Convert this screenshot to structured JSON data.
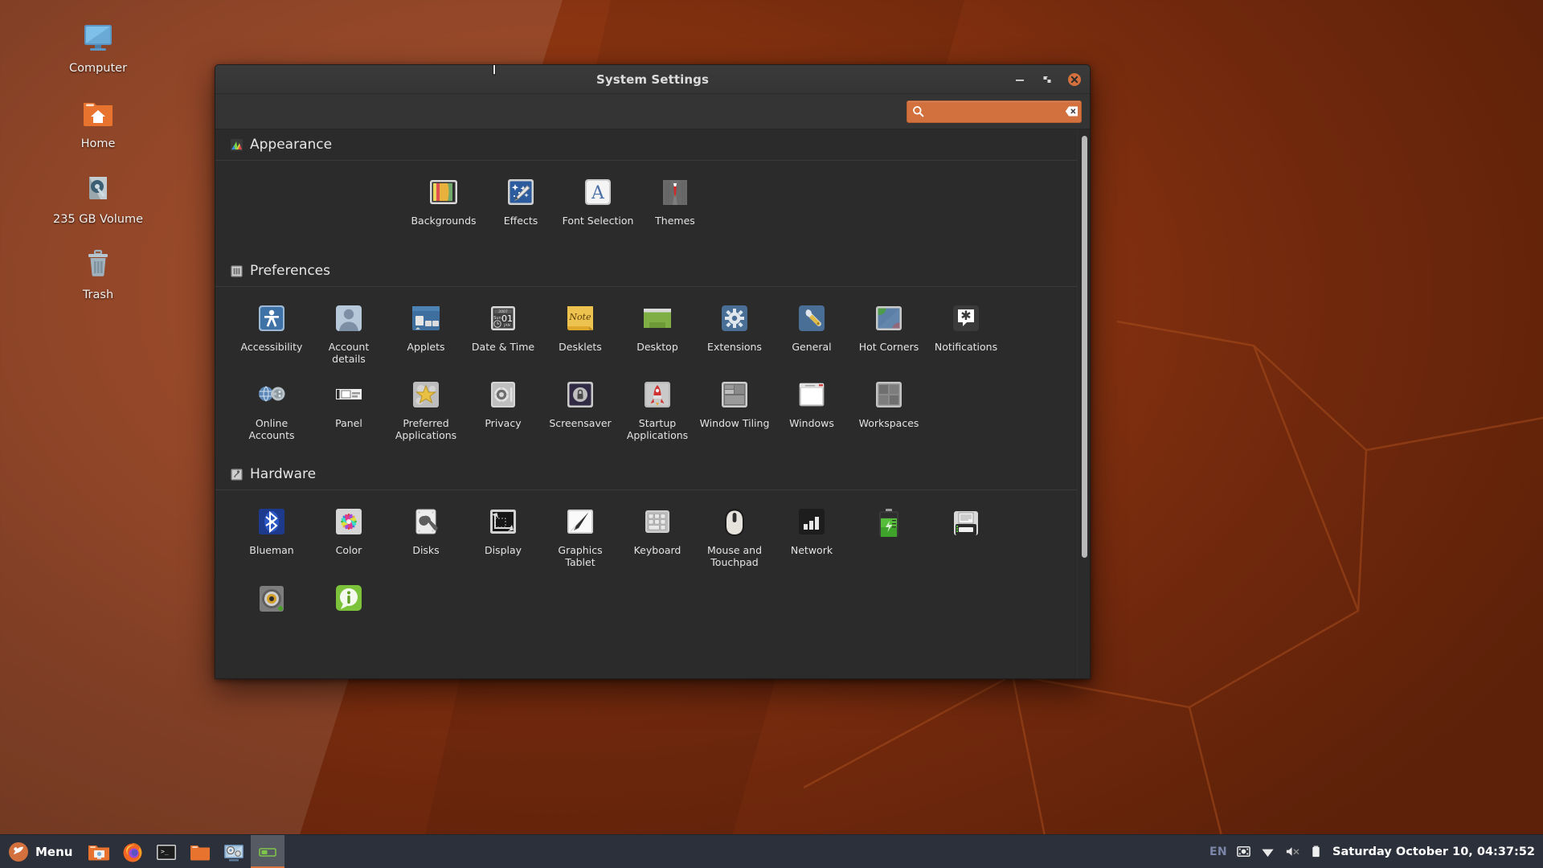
{
  "desktop": {
    "icons": [
      {
        "label": "Computer",
        "icon": "computer-icon"
      },
      {
        "label": "Home",
        "icon": "home-folder-icon"
      },
      {
        "label": "235 GB Volume",
        "icon": "drive-volume-icon"
      },
      {
        "label": "Trash",
        "icon": "trash-icon"
      }
    ]
  },
  "window": {
    "title": "System Settings",
    "controls": {
      "minimize": "minimize-button",
      "maximize": "maximize-button",
      "close": "close-button"
    },
    "search": {
      "value": "",
      "placeholder": "",
      "icon": "search-icon",
      "clear_icon": "clear-icon"
    },
    "scrollbar": {
      "orientation": "vertical"
    }
  },
  "sections": [
    {
      "id": "appearance",
      "title": "Appearance",
      "icon": "appearance-icon",
      "items": [
        {
          "label": "Backgrounds",
          "icon": "backgrounds-icon"
        },
        {
          "label": "Effects",
          "icon": "effects-icon"
        },
        {
          "label": "Font Selection",
          "icon": "font-selection-icon"
        },
        {
          "label": "Themes",
          "icon": "themes-icon"
        }
      ]
    },
    {
      "id": "preferences",
      "title": "Preferences",
      "icon": "preferences-icon",
      "items": [
        {
          "label": "Accessibility",
          "icon": "accessibility-icon"
        },
        {
          "label": "Account details",
          "icon": "account-details-icon"
        },
        {
          "label": "Applets",
          "icon": "applets-icon"
        },
        {
          "label": "Date & Time",
          "icon": "date-time-icon"
        },
        {
          "label": "Desklets",
          "icon": "desklets-icon"
        },
        {
          "label": "Desktop",
          "icon": "desktop-icon"
        },
        {
          "label": "Extensions",
          "icon": "extensions-icon"
        },
        {
          "label": "General",
          "icon": "general-icon"
        },
        {
          "label": "Hot Corners",
          "icon": "hot-corners-icon"
        },
        {
          "label": "Notifications",
          "icon": "notifications-icon"
        },
        {
          "label": "Online Accounts",
          "icon": "online-accounts-icon"
        },
        {
          "label": "Panel",
          "icon": "panel-icon"
        },
        {
          "label": "Preferred Applications",
          "icon": "preferred-applications-icon"
        },
        {
          "label": "Privacy",
          "icon": "privacy-icon"
        },
        {
          "label": "Screensaver",
          "icon": "screensaver-icon"
        },
        {
          "label": "Startup Applications",
          "icon": "startup-applications-icon"
        },
        {
          "label": "Window Tiling",
          "icon": "window-tiling-icon"
        },
        {
          "label": "Windows",
          "icon": "windows-icon"
        },
        {
          "label": "Workspaces",
          "icon": "workspaces-icon"
        }
      ]
    },
    {
      "id": "hardware",
      "title": "Hardware",
      "icon": "hardware-icon",
      "items": [
        {
          "label": "Blueman",
          "icon": "bluetooth-icon"
        },
        {
          "label": "Color",
          "icon": "color-icon"
        },
        {
          "label": "Disks",
          "icon": "disks-icon"
        },
        {
          "label": "Display",
          "icon": "display-icon"
        },
        {
          "label": "Graphics Tablet",
          "icon": "graphics-tablet-icon"
        },
        {
          "label": "Keyboard",
          "icon": "keyboard-icon"
        },
        {
          "label": "Mouse and Touchpad",
          "icon": "mouse-touchpad-icon"
        },
        {
          "label": "Network",
          "icon": "network-icon"
        },
        {
          "label": "",
          "icon": "power-icon"
        },
        {
          "label": "",
          "icon": "printers-icon"
        },
        {
          "label": "",
          "icon": "sound-icon"
        },
        {
          "label": "",
          "icon": "system-info-icon"
        }
      ]
    }
  ],
  "taskbar": {
    "menu_label": "Menu",
    "menu_icon": "cinnamon-menu-icon",
    "launchers": [
      {
        "name": "show-desktop",
        "icon": "show-desktop-icon"
      },
      {
        "name": "firefox",
        "icon": "firefox-icon"
      },
      {
        "name": "terminal",
        "icon": "terminal-icon"
      },
      {
        "name": "files",
        "icon": "files-icon"
      },
      {
        "name": "system-settings",
        "icon": "system-settings-icon"
      },
      {
        "name": "window-task",
        "icon": "window-task-icon"
      }
    ],
    "tray": {
      "language": "EN",
      "icons": [
        "keyboard-layout-icon",
        "network-wifi-icon",
        "volume-muted-icon",
        "battery-icon"
      ],
      "clock": "Saturday October 10, 04:37:52"
    }
  },
  "colors": {
    "accent": "#d2703e",
    "window_bg": "#2b2b2b",
    "titlebar_bg": "#3b3b3b",
    "taskbar_bg": "#2c303a",
    "desktop_bg": "#8a3411",
    "close_button": "#d2703e"
  }
}
